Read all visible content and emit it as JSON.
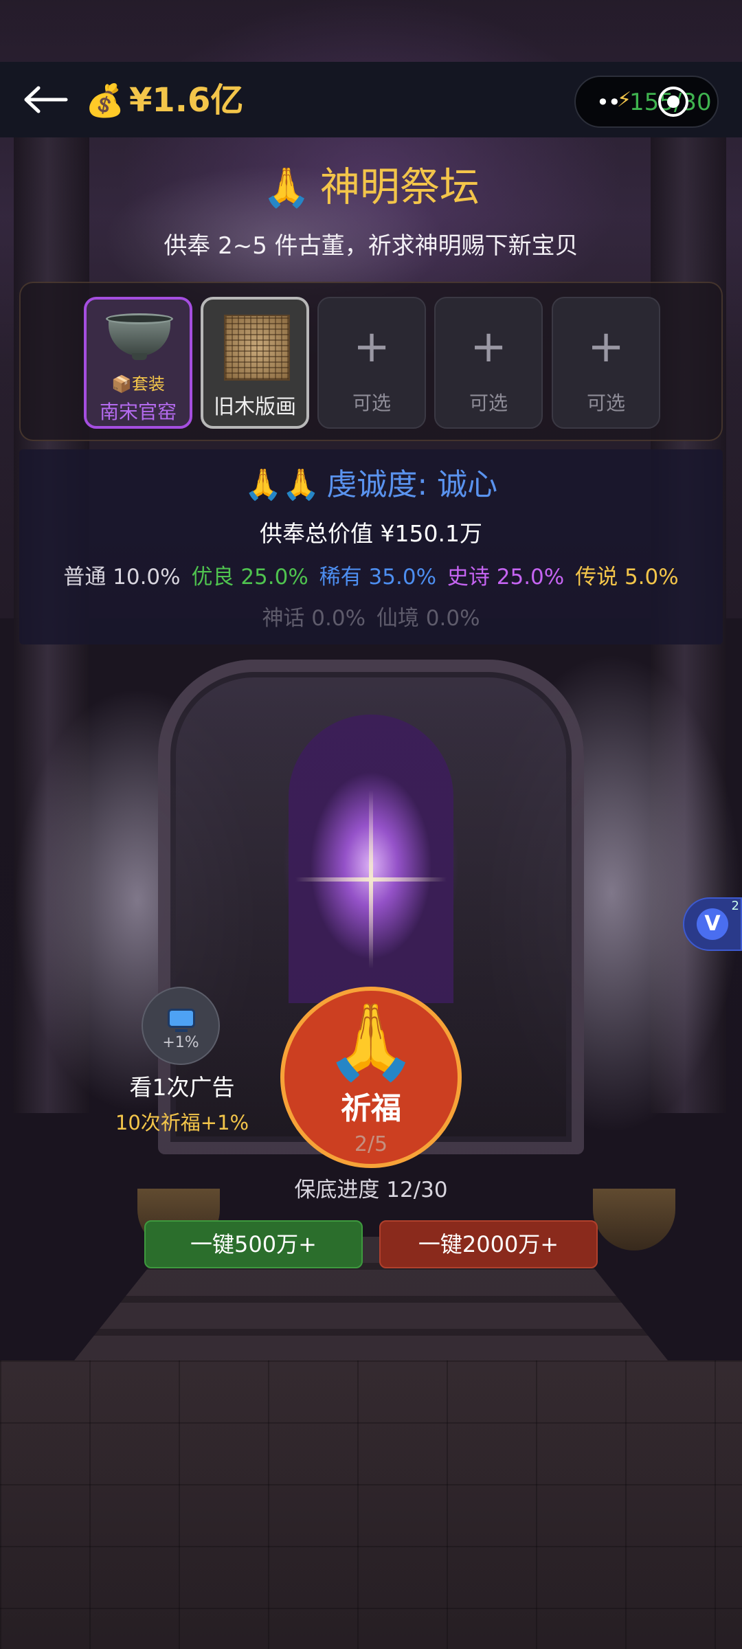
{
  "header": {
    "money_icon": "💰",
    "money_value": "¥1.6亿",
    "capsule_text": "155/30",
    "capsule_dots": "••",
    "bolt_icon": "⚡"
  },
  "altar": {
    "title_icon": "🙏",
    "title": "神明祭坛",
    "subtitle": "供奉 2~5 件古董，祈求神明赐下新宝贝"
  },
  "slots": [
    {
      "name": "南宋官窑",
      "tag": "📦套装",
      "rarity_color": "#a54ee0",
      "icon": "bowl-icon"
    },
    {
      "name": "旧木版画",
      "rarity_color": "#b8b8b8",
      "icon": "woodcut-icon"
    },
    {
      "plus": "+",
      "label": "可选"
    },
    {
      "plus": "+",
      "label": "可选"
    },
    {
      "plus": "+",
      "label": "可选"
    }
  ],
  "stats": {
    "piety_icon": "🙏🙏",
    "piety_label": "虔诚度: 诚心",
    "total_value": "供奉总价值 ¥150.1万",
    "rates": [
      {
        "label": "普通 10.0%",
        "color": "#d9d6df"
      },
      {
        "label": "优良 25.0%",
        "color": "#4fc34f"
      },
      {
        "label": "稀有 35.0%",
        "color": "#4d8ef0"
      },
      {
        "label": "史诗 25.0%",
        "color": "#c564f2"
      },
      {
        "label": "传说 5.0%",
        "color": "#f3c54a"
      }
    ],
    "rates_extra": [
      {
        "label": "神话 0.0%"
      },
      {
        "label": "仙境 0.0%"
      }
    ]
  },
  "actions": {
    "ad_pct": "+1%",
    "ad_label": "看1次广告",
    "ad_sub": "10次祈福+1%",
    "pray_icon": "🙏",
    "pray_label": "祈福",
    "pray_count": "2/5",
    "guarantee": "保底进度 12/30",
    "quick_500": "一键500万+",
    "quick_2000": "一键2000万+"
  },
  "float_badge": {
    "letter": "V",
    "count": "2"
  }
}
